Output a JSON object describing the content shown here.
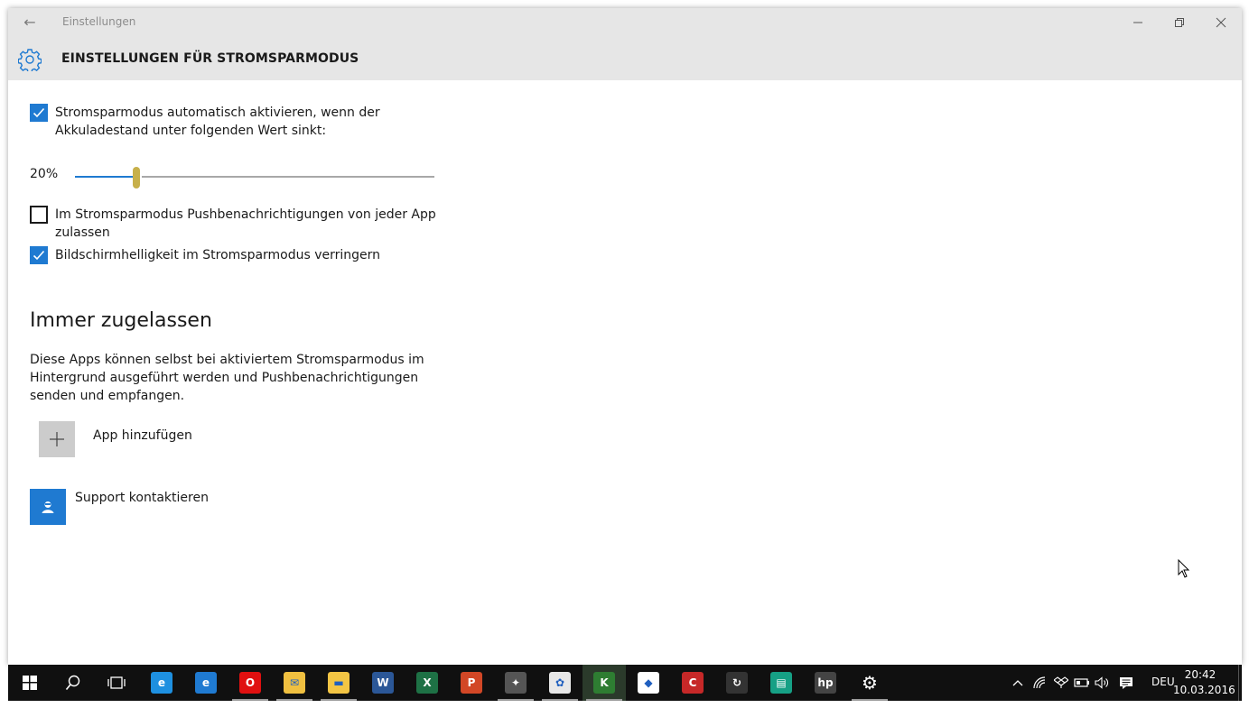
{
  "window": {
    "app_title": "Einstellungen",
    "page_title": "EINSTELLUNGEN FÜR STROMSPARMODUS"
  },
  "settings": {
    "auto_activate": {
      "checked": true,
      "label_line1": "Stromsparmodus automatisch aktivieren, wenn der",
      "label_line2": "Akkuladestand unter folgenden Wert sinkt:"
    },
    "threshold": {
      "value_label": "20%",
      "value_fraction": 0.17
    },
    "push_notifications": {
      "checked": false,
      "label_line1": "Im Stromsparmodus Pushbenachrichtigungen von jeder App",
      "label_line2": "zulassen"
    },
    "reduce_brightness": {
      "checked": true,
      "label": "Bildschirmhelligkeit im Stromsparmodus verringern"
    }
  },
  "always_allowed": {
    "title": "Immer zugelassen",
    "description_line1": "Diese Apps können selbst bei aktiviertem Stromsparmodus im",
    "description_line2": "Hintergrund ausgeführt werden und Pushbenachrichtigungen",
    "description_line3": "senden und empfangen.",
    "add_app_label": "App hinzufügen"
  },
  "support": {
    "label": "Support kontaktieren"
  },
  "taskbar": {
    "apps": [
      {
        "name": "internet-explorer-icon",
        "color": "#1e90e0",
        "glyph": "e"
      },
      {
        "name": "edge-icon",
        "color": "#1f7ad1",
        "glyph": "e"
      },
      {
        "name": "opera-icon",
        "color": "#e01010",
        "glyph": "O"
      },
      {
        "name": "mail-icon",
        "color": "#f0c040",
        "glyph": "✉"
      },
      {
        "name": "file-explorer-icon",
        "color": "#f3c544",
        "glyph": "▬"
      },
      {
        "name": "word-icon",
        "color": "#2b5797",
        "glyph": "W"
      },
      {
        "name": "excel-icon",
        "color": "#1e7145",
        "glyph": "X"
      },
      {
        "name": "powerpoint-icon",
        "color": "#d24726",
        "glyph": "P"
      },
      {
        "name": "game-icon",
        "color": "#555555",
        "glyph": "✦"
      },
      {
        "name": "photos-icon",
        "color": "#e8e8e8",
        "glyph": "✿"
      },
      {
        "name": "kaspersky-icon",
        "color": "#2e7d32",
        "glyph": "K"
      },
      {
        "name": "dropbox-icon",
        "color": "#ffffff",
        "glyph": "◆"
      },
      {
        "name": "ccleaner-icon",
        "color": "#c62828",
        "glyph": "C"
      },
      {
        "name": "refresh-app-icon",
        "color": "#333333",
        "glyph": "↻"
      },
      {
        "name": "money-app-icon",
        "color": "#16a085",
        "glyph": "▤"
      },
      {
        "name": "hp-icon",
        "color": "#444444",
        "glyph": "hp"
      },
      {
        "name": "settings-gear-icon",
        "color": "#101010",
        "glyph": "⚙"
      }
    ],
    "language": "DEU",
    "time": "20:42",
    "date": "10.03.2016"
  },
  "colors": {
    "accent": "#1f7ad1",
    "title_bar": "#e6e6e6",
    "taskbar": "#101010",
    "slider_thumb": "#c7b04a"
  }
}
